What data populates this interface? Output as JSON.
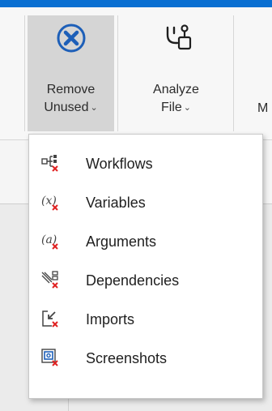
{
  "ribbon": {
    "remove_unused": {
      "line1": "Remove",
      "line2": "Unused",
      "caret": "⌄",
      "icon": "remove-circle-x-icon"
    },
    "analyze_file": {
      "line1": "Analyze",
      "line2": "File",
      "caret": "⌄",
      "icon": "analyze-file-icon"
    },
    "partial_label": "M"
  },
  "menu": {
    "items": [
      {
        "label": "Workflows",
        "icon": "workflows-remove-icon"
      },
      {
        "label": "Variables",
        "icon": "variables-remove-icon"
      },
      {
        "label": "Arguments",
        "icon": "arguments-remove-icon"
      },
      {
        "label": "Dependencies",
        "icon": "dependencies-remove-icon"
      },
      {
        "label": "Imports",
        "icon": "imports-remove-icon"
      },
      {
        "label": "Screenshots",
        "icon": "screenshots-remove-icon"
      }
    ]
  },
  "colors": {
    "accent": "#0a6fd1",
    "remove_red": "#e02020",
    "icon_blue": "#1d5fb8"
  }
}
